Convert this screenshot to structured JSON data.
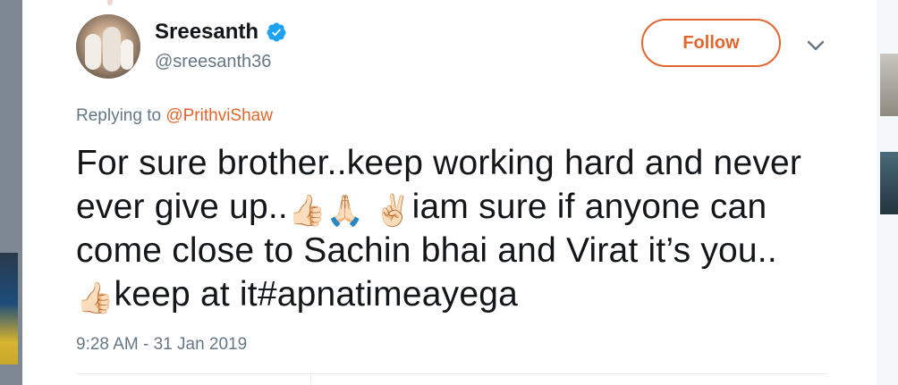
{
  "tweet": {
    "display_name": "Sreesanth",
    "handle": "@sreesanth36",
    "follow_label": "Follow",
    "replying_prefix": "Replying to",
    "replying_to": "@PrithviShaw",
    "text_segments": {
      "s1": "For sure brother..keep working hard and never ever give up..",
      "e1": "👍🏻",
      "e2": "🙏🏻",
      "e3": "✌🏻",
      "s2": "iam sure if anyone can come close to Sachin bhai and Virat it’s you..",
      "e4": "👍🏻",
      "s3": "keep at it#apnatimeayega"
    },
    "timestamp": "9:28 AM - 31 Jan 2019"
  },
  "icons": {
    "verified": "verified-badge-icon",
    "menu": "chevron-down-icon"
  },
  "colors": {
    "accent": "#e0662e",
    "verified": "#1da1f2",
    "text": "#14171a",
    "secondary": "#657786"
  }
}
